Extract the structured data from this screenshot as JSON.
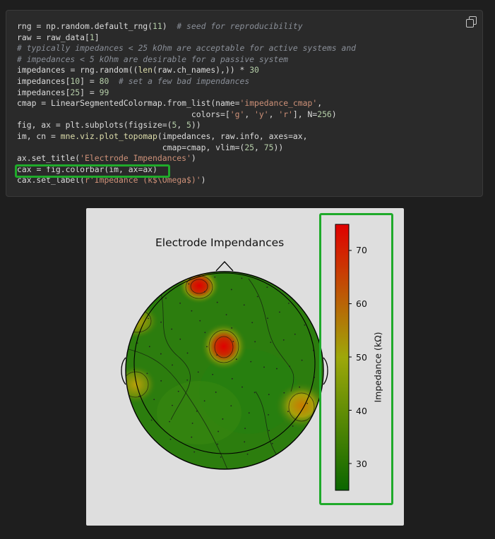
{
  "code": {
    "lines": [
      [
        {
          "t": "rng ",
          "c": ""
        },
        {
          "t": "= ",
          "c": "op"
        },
        {
          "t": "np.random.default_rng(",
          "c": ""
        },
        {
          "t": "11",
          "c": "num"
        },
        {
          "t": ")  ",
          "c": ""
        },
        {
          "t": "# seed for reproducibility",
          "c": "com"
        }
      ],
      [
        {
          "t": "raw ",
          "c": ""
        },
        {
          "t": "= ",
          "c": "op"
        },
        {
          "t": "raw_data[",
          "c": ""
        },
        {
          "t": "1",
          "c": "num"
        },
        {
          "t": "]",
          "c": ""
        }
      ],
      [
        {
          "t": "# typically impedances < 25 kOhm are acceptable for active systems and",
          "c": "com"
        }
      ],
      [
        {
          "t": "# impedances < 5 kOhm are desirable for a passive system",
          "c": "com"
        }
      ],
      [
        {
          "t": "impedances ",
          "c": ""
        },
        {
          "t": "= ",
          "c": "op"
        },
        {
          "t": "rng.random((",
          "c": ""
        },
        {
          "t": "len",
          "c": "fn"
        },
        {
          "t": "(raw.ch_names),)) ",
          "c": ""
        },
        {
          "t": "* ",
          "c": "op"
        },
        {
          "t": "30",
          "c": "num"
        }
      ],
      [
        {
          "t": "impedances[",
          "c": ""
        },
        {
          "t": "10",
          "c": "num"
        },
        {
          "t": "] ",
          "c": ""
        },
        {
          "t": "= ",
          "c": "op"
        },
        {
          "t": "80  ",
          "c": "num"
        },
        {
          "t": "# set a few bad impendances",
          "c": "com"
        }
      ],
      [
        {
          "t": "impedances[",
          "c": ""
        },
        {
          "t": "25",
          "c": "num"
        },
        {
          "t": "] ",
          "c": ""
        },
        {
          "t": "= ",
          "c": "op"
        },
        {
          "t": "99",
          "c": "num"
        }
      ],
      [
        {
          "t": "cmap ",
          "c": ""
        },
        {
          "t": "= ",
          "c": "op"
        },
        {
          "t": "LinearSegmentedColormap.from_list(name",
          "c": ""
        },
        {
          "t": "=",
          "c": "op"
        },
        {
          "t": "'impedance_cmap'",
          "c": "str"
        },
        {
          "t": ",",
          "c": ""
        }
      ],
      [
        {
          "t": "                                    colors",
          "c": ""
        },
        {
          "t": "=",
          "c": "op"
        },
        {
          "t": "[",
          "c": ""
        },
        {
          "t": "'g'",
          "c": "str"
        },
        {
          "t": ", ",
          "c": ""
        },
        {
          "t": "'y'",
          "c": "str"
        },
        {
          "t": ", ",
          "c": ""
        },
        {
          "t": "'r'",
          "c": "str"
        },
        {
          "t": "], N",
          "c": ""
        },
        {
          "t": "=",
          "c": "op"
        },
        {
          "t": "256",
          "c": "num"
        },
        {
          "t": ")",
          "c": ""
        }
      ],
      [
        {
          "t": "fig, ax ",
          "c": ""
        },
        {
          "t": "= ",
          "c": "op"
        },
        {
          "t": "plt.subplots(figsize",
          "c": ""
        },
        {
          "t": "=",
          "c": "op"
        },
        {
          "t": "(",
          "c": ""
        },
        {
          "t": "5",
          "c": "num"
        },
        {
          "t": ", ",
          "c": ""
        },
        {
          "t": "5",
          "c": "num"
        },
        {
          "t": "))",
          "c": ""
        }
      ],
      [
        {
          "t": "im, cn ",
          "c": ""
        },
        {
          "t": "= ",
          "c": "op"
        },
        {
          "t": "mne.viz.plot_topomap",
          "c": "fn"
        },
        {
          "t": "(impedances, raw.info, axes",
          "c": ""
        },
        {
          "t": "=",
          "c": "op"
        },
        {
          "t": "ax,",
          "c": ""
        }
      ],
      [
        {
          "t": "                              cmap",
          "c": ""
        },
        {
          "t": "=",
          "c": "op"
        },
        {
          "t": "cmap, vlim",
          "c": ""
        },
        {
          "t": "=",
          "c": "op"
        },
        {
          "t": "(",
          "c": ""
        },
        {
          "t": "25",
          "c": "num"
        },
        {
          "t": ", ",
          "c": ""
        },
        {
          "t": "75",
          "c": "num"
        },
        {
          "t": "))",
          "c": ""
        }
      ],
      [
        {
          "t": "ax.set_title(",
          "c": ""
        },
        {
          "t": "'Electrode Impendances'",
          "c": "str"
        },
        {
          "t": ")",
          "c": ""
        }
      ],
      [
        {
          "t": "cax ",
          "c": ""
        },
        {
          "t": "= ",
          "c": "op"
        },
        {
          "t": "fig.colorbar(im, ax",
          "c": ""
        },
        {
          "t": "=",
          "c": "op"
        },
        {
          "t": "ax)",
          "c": ""
        }
      ],
      [
        {
          "t": "cax.set_label(",
          "c": ""
        },
        {
          "t": "r'Impedance (k$\\Omega$)'",
          "c": "str"
        },
        {
          "t": ")",
          "c": ""
        }
      ]
    ]
  },
  "figure": {
    "title": "Electrode Impendances",
    "colorbar_label": "Impedance (kΩ)",
    "colorbar_ticks": [
      "70",
      "60",
      "50",
      "40",
      "30"
    ],
    "colors": {
      "low": "#1a6e0a",
      "mid": "#9da60a",
      "high": "#e00000",
      "highlight": "#1faa2a"
    }
  },
  "chart_data": {
    "type": "heatmap",
    "title": "Electrode Impendances",
    "colorbar": {
      "label": "Impedance (kΩ)",
      "vlim": [
        25,
        75
      ],
      "ticks": [
        30,
        40,
        50,
        60,
        70
      ],
      "cmap": [
        "g",
        "y",
        "r"
      ]
    },
    "hotspots": [
      "frontal-left high (~75)",
      "central high (~75)",
      "temporal-left moderate (~50)",
      "temporal-right moderate (~55)"
    ]
  }
}
